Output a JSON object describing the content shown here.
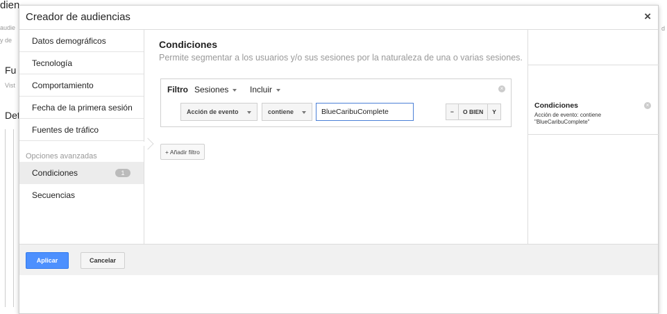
{
  "background": {
    "fragments": [
      "dien",
      "audie",
      "y de",
      "Fu",
      "Vist",
      "Det",
      "d"
    ]
  },
  "dialog": {
    "title": "Creador de audiencias",
    "close_label": "×"
  },
  "nav": {
    "items": [
      {
        "label": "Datos demográficos"
      },
      {
        "label": "Tecnología"
      },
      {
        "label": "Comportamiento"
      },
      {
        "label": "Fecha de la primera sesión"
      },
      {
        "label": "Fuentes de tráfico"
      }
    ],
    "advanced_heading": "Opciones avanzadas",
    "advanced_items": [
      {
        "label": "Condiciones",
        "badge": "1",
        "active": true
      },
      {
        "label": "Secuencias"
      }
    ]
  },
  "conditions": {
    "title": "Condiciones",
    "subtitle": "Permite segmentar a los usuarios y/o sus sesiones por la naturaleza de una o varias sesiones.",
    "filter": {
      "label": "Filtro",
      "scope": "Sesiones",
      "mode": "Incluir",
      "dimension": "Acción de evento",
      "operator": "contiene",
      "value": "BlueCaribuComplete",
      "buttons": [
        "−",
        "O BIEN",
        "Y"
      ]
    },
    "add_filter_label": "+ Añadir filtro"
  },
  "summary": {
    "title": "Condiciones",
    "description": "Acción de evento: contiene \"BlueCaribuComplete\""
  },
  "footer": {
    "apply_label": "Aplicar",
    "cancel_label": "Cancelar"
  }
}
